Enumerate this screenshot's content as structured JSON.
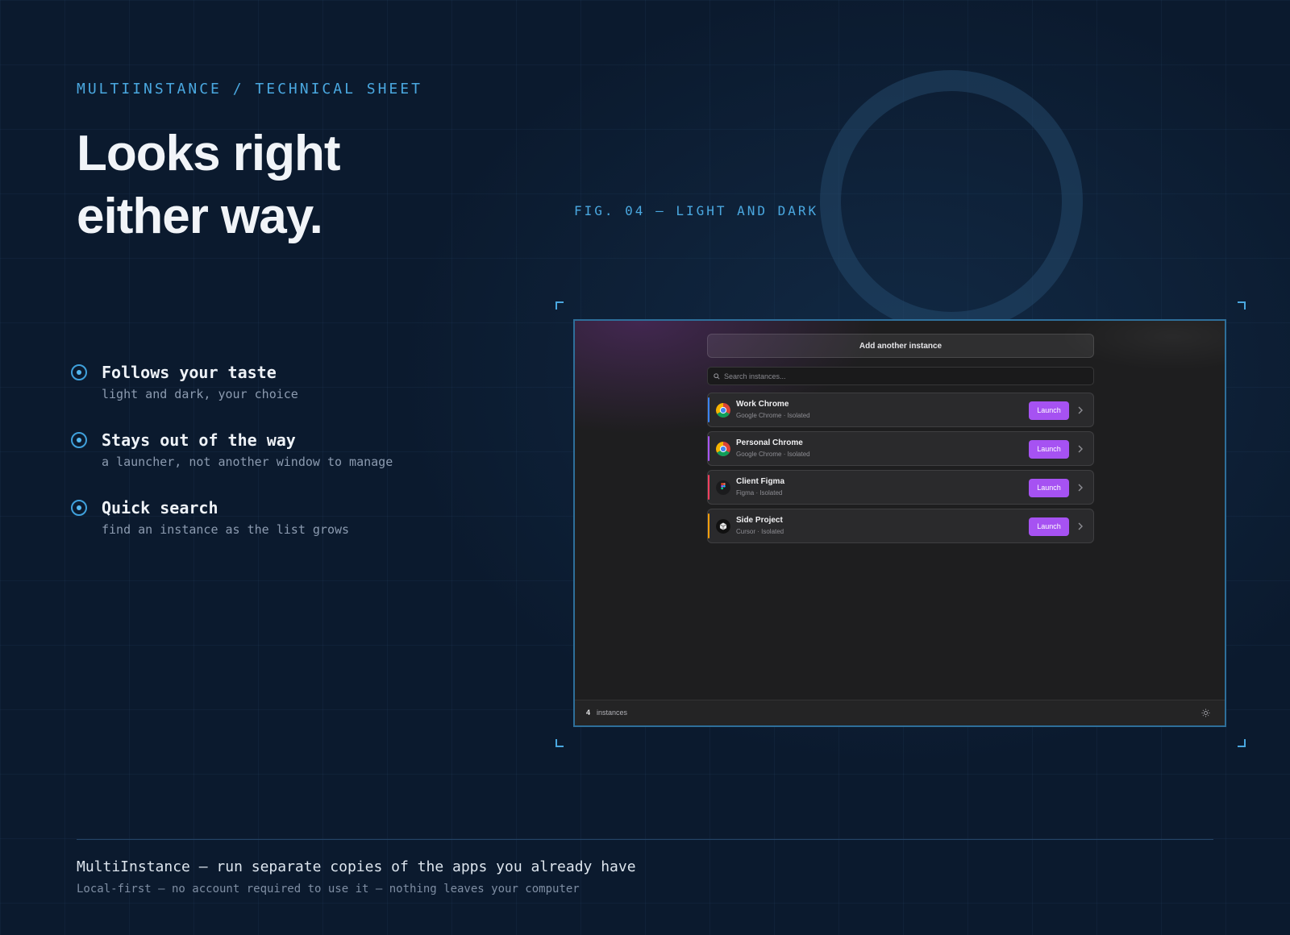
{
  "page": {
    "eyebrow": "MULTIINSTANCE / TECHNICAL SHEET",
    "headline_line1": "Looks right",
    "headline_line2": "either way.",
    "fig_label": "FIG. 04 — LIGHT AND DARK",
    "accent_color": "#4aa8e0"
  },
  "features": [
    {
      "title": "Follows your taste",
      "subtitle": "light and dark, your choice"
    },
    {
      "title": "Stays out of the way",
      "subtitle": "a launcher, not another window to manage"
    },
    {
      "title": "Quick search",
      "subtitle": "find an instance as the list grows"
    }
  ],
  "app": {
    "add_button_label": "Add another instance",
    "search_placeholder": "Search instances...",
    "launch_button_color": "#a652f2",
    "instances": [
      {
        "name": "Work Chrome",
        "subtitle": "Google Chrome · Isolated",
        "icon": "chrome-icon",
        "accent_color": "#3b82f6",
        "launch_label": "Launch"
      },
      {
        "name": "Personal Chrome",
        "subtitle": "Google Chrome · Isolated",
        "icon": "chrome-icon",
        "accent_color": "#a855f7",
        "launch_label": "Launch"
      },
      {
        "name": "Client Figma",
        "subtitle": "Figma · Isolated",
        "icon": "figma-icon",
        "accent_color": "#f43f5e",
        "launch_label": "Launch"
      },
      {
        "name": "Side Project",
        "subtitle": "Cursor · Isolated",
        "icon": "cursor-icon",
        "accent_color": "#f59e0b",
        "launch_label": "Launch"
      }
    ],
    "status": {
      "count": "4",
      "count_label": "instances",
      "theme_icon": "sun-icon"
    }
  },
  "footer": {
    "title": "MultiInstance — run separate copies of the apps you already have",
    "subtitle": "Local-first — no account required to use it — nothing leaves your computer"
  }
}
